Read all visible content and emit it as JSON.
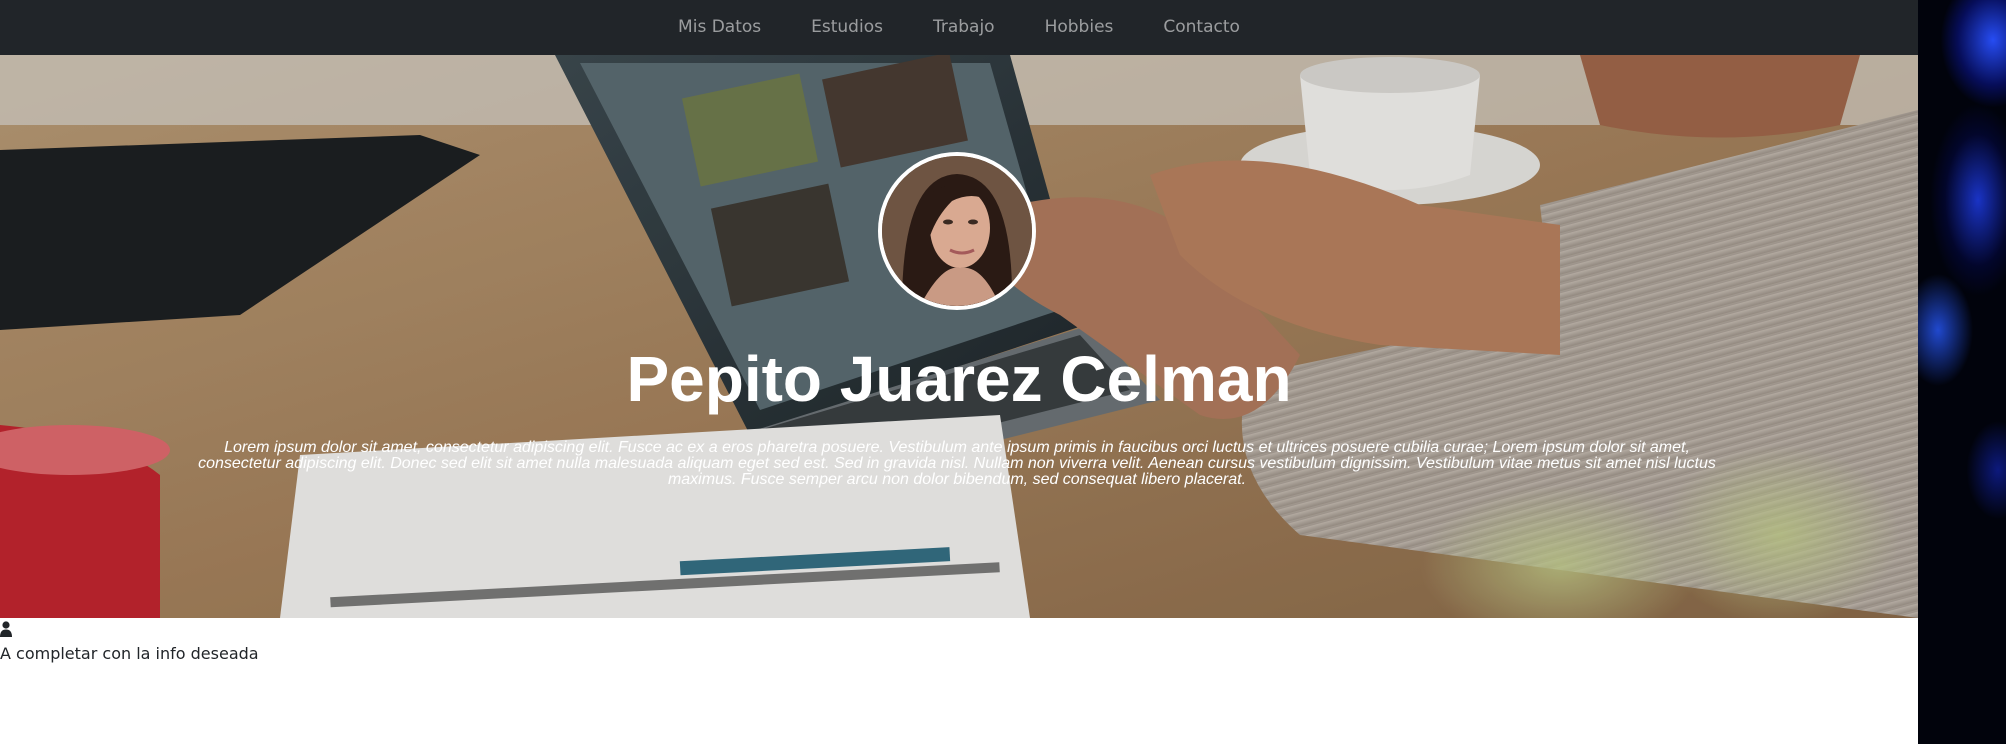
{
  "nav": {
    "items": [
      {
        "label": "Mis Datos"
      },
      {
        "label": "Estudios"
      },
      {
        "label": "Trabajo"
      },
      {
        "label": "Hobbies"
      },
      {
        "label": "Contacto"
      }
    ]
  },
  "hero": {
    "name": "Pepito Juarez Celman",
    "description": "Lorem ipsum dolor sit amet, consectetur adipiscing elit. Fusce ac ex a eros pharetra posuere. Vestibulum ante ipsum primis in faucibus orci luctus et ultrices posuere cubilia curae; Lorem ipsum dolor sit amet, consectetur adipiscing elit. Donec sed elit sit amet nulla malesuada aliquam eget sed est. Sed in gravida nisl. Nullam non viverra velit. Aenean cursus vestibulum dignissim. Vestibulum vitae metus sit amet nisl luctus maximus. Fusce semper arcu non dolor bibendum, sed consequat libero placerat.",
    "background_image": "desk-laptop-hands-photo",
    "avatar_image": "woman-portrait-photo"
  },
  "about": {
    "icon": "user-icon",
    "text": "A completar con la info deseada"
  },
  "colors": {
    "navbar_bg": "#212529",
    "nav_link": "#8c8f92",
    "hero_text": "#ffffff",
    "body_text": "#212529"
  }
}
